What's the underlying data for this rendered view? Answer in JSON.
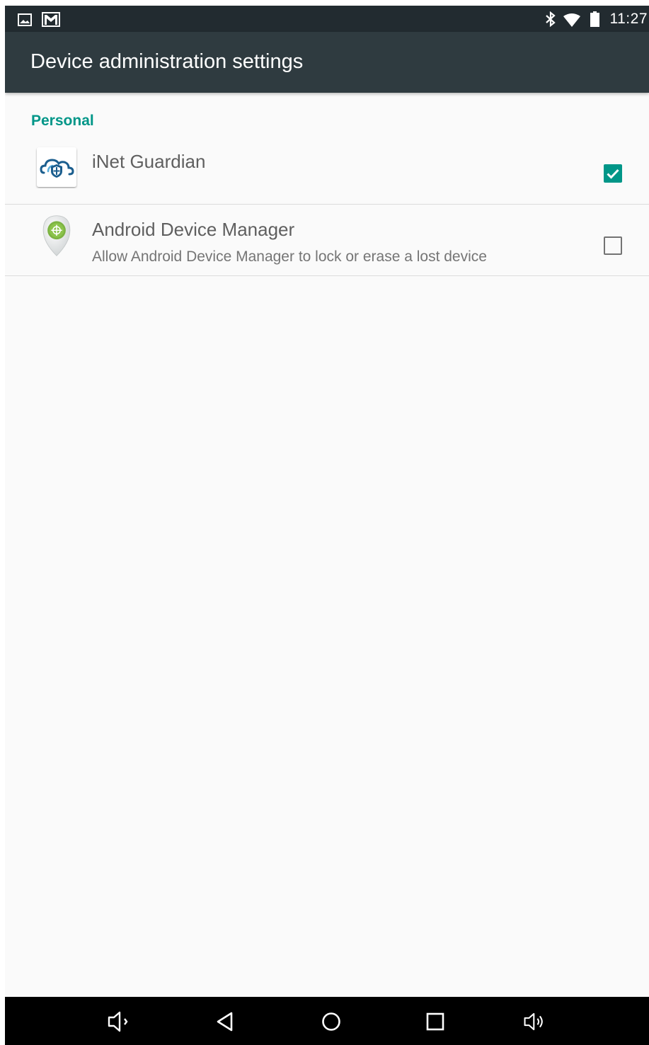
{
  "status_bar": {
    "time": "11:27",
    "icons": [
      "image-notification-icon",
      "gmail-icon",
      "bluetooth-icon",
      "wifi-icon",
      "battery-icon"
    ]
  },
  "toolbar": {
    "title": "Device administration settings"
  },
  "list": {
    "section_header": "Personal",
    "items": [
      {
        "title": "iNet Guardian",
        "summary": "",
        "checked": true,
        "icon": "inet-guardian-app-icon"
      },
      {
        "title": "Android Device Manager",
        "summary": "Allow Android Device Manager to lock or erase a lost device",
        "checked": false,
        "icon": "android-device-manager-app-icon"
      }
    ]
  },
  "nav_bar": {
    "buttons": [
      "volume-down-icon",
      "back-icon",
      "home-icon",
      "recents-icon",
      "volume-up-icon"
    ]
  },
  "colors": {
    "accent": "#009688",
    "toolbar": "#2f3b40",
    "status_bar": "#222b30",
    "background": "#fafafa"
  }
}
